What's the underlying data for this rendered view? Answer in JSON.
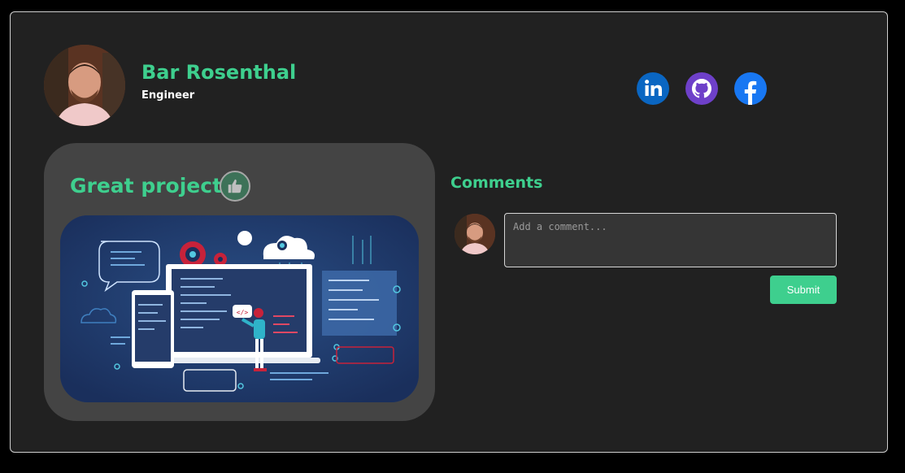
{
  "profile": {
    "name": "Bar Rosenthal",
    "role": "Engineer",
    "avatar_icon": "user-photo"
  },
  "social": [
    {
      "name": "LinkedIn",
      "icon": "linkedin-icon",
      "color": "#0a66c2"
    },
    {
      "name": "GitHub",
      "icon": "github-icon",
      "color": "#6e40c9"
    },
    {
      "name": "Facebook",
      "icon": "facebook-icon",
      "color": "#1877f2"
    }
  ],
  "project": {
    "title": "Great project",
    "like_icon": "thumbs-up-icon",
    "image_icon": "developer-illustration"
  },
  "comments": {
    "title": "Comments",
    "placeholder": "Add a comment...",
    "submit_label": "Submit"
  },
  "colors": {
    "accent": "#3ecf8e",
    "card": "#212121",
    "panel": "#444444"
  }
}
